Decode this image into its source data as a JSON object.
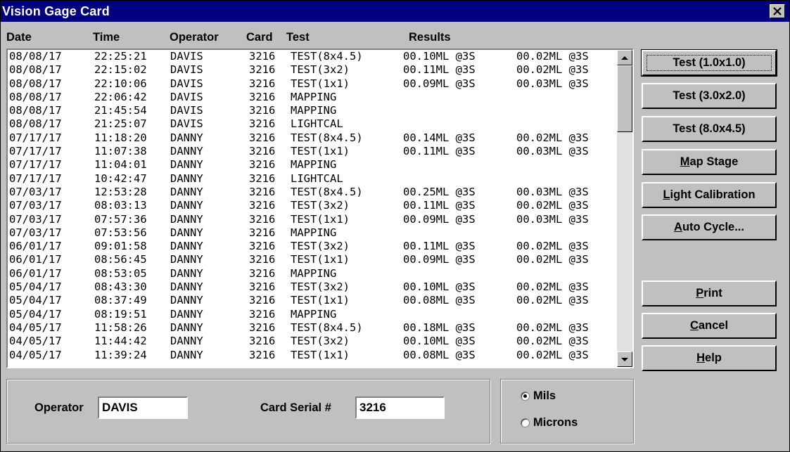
{
  "window": {
    "title": "Vision Gage Card"
  },
  "table": {
    "headers": {
      "date": "Date",
      "time": "Time",
      "operator": "Operator",
      "card": "Card",
      "test": "Test",
      "results": "Results"
    },
    "rows": [
      [
        "08/08/17",
        "22:25:21",
        "DAVIS",
        "3216",
        "TEST(8x4.5)",
        "00.10ML @3S",
        "00.02ML @3S"
      ],
      [
        "08/08/17",
        "22:15:02",
        "DAVIS",
        "3216",
        "TEST(3x2)",
        "00.11ML @3S",
        "00.02ML @3S"
      ],
      [
        "08/08/17",
        "22:10:06",
        "DAVIS",
        "3216",
        "TEST(1x1)",
        "00.09ML @3S",
        "00.03ML @3S"
      ],
      [
        "08/08/17",
        "22:06:42",
        "DAVIS",
        "3216",
        "MAPPING",
        "",
        ""
      ],
      [
        "08/08/17",
        "21:45:54",
        "DAVIS",
        "3216",
        "MAPPING",
        "",
        ""
      ],
      [
        "08/08/17",
        "21:25:07",
        "DAVIS",
        "3216",
        "LIGHTCAL",
        "",
        ""
      ],
      [
        "07/17/17",
        "11:18:20",
        "DANNY",
        "3216",
        "TEST(8x4.5)",
        "00.14ML @3S",
        "00.02ML @3S"
      ],
      [
        "07/17/17",
        "11:07:38",
        "DANNY",
        "3216",
        "TEST(1x1)",
        "00.11ML @3S",
        "00.03ML @3S"
      ],
      [
        "07/17/17",
        "11:04:01",
        "DANNY",
        "3216",
        "MAPPING",
        "",
        ""
      ],
      [
        "07/17/17",
        "10:42:47",
        "DANNY",
        "3216",
        "LIGHTCAL",
        "",
        ""
      ],
      [
        "07/03/17",
        "12:53:28",
        "DANNY",
        "3216",
        "TEST(8x4.5)",
        "00.25ML @3S",
        "00.03ML @3S"
      ],
      [
        "07/03/17",
        "08:03:13",
        "DANNY",
        "3216",
        "TEST(3x2)",
        "00.11ML @3S",
        "00.02ML @3S"
      ],
      [
        "07/03/17",
        "07:57:36",
        "DANNY",
        "3216",
        "TEST(1x1)",
        "00.09ML @3S",
        "00.03ML @3S"
      ],
      [
        "07/03/17",
        "07:53:56",
        "DANNY",
        "3216",
        "MAPPING",
        "",
        ""
      ],
      [
        "06/01/17",
        "09:01:58",
        "DANNY",
        "3216",
        "TEST(3x2)",
        "00.11ML @3S",
        "00.02ML @3S"
      ],
      [
        "06/01/17",
        "08:56:45",
        "DANNY",
        "3216",
        "TEST(1x1)",
        "00.09ML @3S",
        "00.02ML @3S"
      ],
      [
        "06/01/17",
        "08:53:05",
        "DANNY",
        "3216",
        "MAPPING",
        "",
        ""
      ],
      [
        "05/04/17",
        "08:43:30",
        "DANNY",
        "3216",
        "TEST(3x2)",
        "00.10ML @3S",
        "00.02ML @3S"
      ],
      [
        "05/04/17",
        "08:37:49",
        "DANNY",
        "3216",
        "TEST(1x1)",
        "00.08ML @3S",
        "00.02ML @3S"
      ],
      [
        "05/04/17",
        "08:19:51",
        "DANNY",
        "3216",
        "MAPPING",
        "",
        ""
      ],
      [
        "04/05/17",
        "11:58:26",
        "DANNY",
        "3216",
        "TEST(8x4.5)",
        "00.18ML @3S",
        "00.02ML @3S"
      ],
      [
        "04/05/17",
        "11:44:42",
        "DANNY",
        "3216",
        "TEST(3x2)",
        "00.10ML @3S",
        "00.02ML @3S"
      ],
      [
        "04/05/17",
        "11:39:24",
        "DANNY",
        "3216",
        "TEST(1x1)",
        "00.08ML @3S",
        "00.02ML @3S"
      ]
    ]
  },
  "buttons": {
    "test1": "Test (1.0x1.0)",
    "test2": "Test (3.0x2.0)",
    "test3": "Test (8.0x4.5)",
    "map_stage": {
      "mnemonic": "M",
      "rest": "ap Stage"
    },
    "light_cal": {
      "mnemonic": "L",
      "rest": "ight Calibration"
    },
    "auto_cycle": {
      "mnemonic": "A",
      "rest": "uto Cycle..."
    },
    "print": {
      "mnemonic": "P",
      "rest": "rint"
    },
    "cancel": {
      "mnemonic": "C",
      "rest": "ancel"
    },
    "help": {
      "mnemonic": "H",
      "rest": "elp"
    }
  },
  "form": {
    "operator_label": "Operator",
    "operator_value": "DAVIS",
    "card_label": "Card Serial #",
    "card_value": "3216"
  },
  "units": {
    "mils_label": "Mils",
    "microns_label": "Microns",
    "selected": "Mils"
  }
}
